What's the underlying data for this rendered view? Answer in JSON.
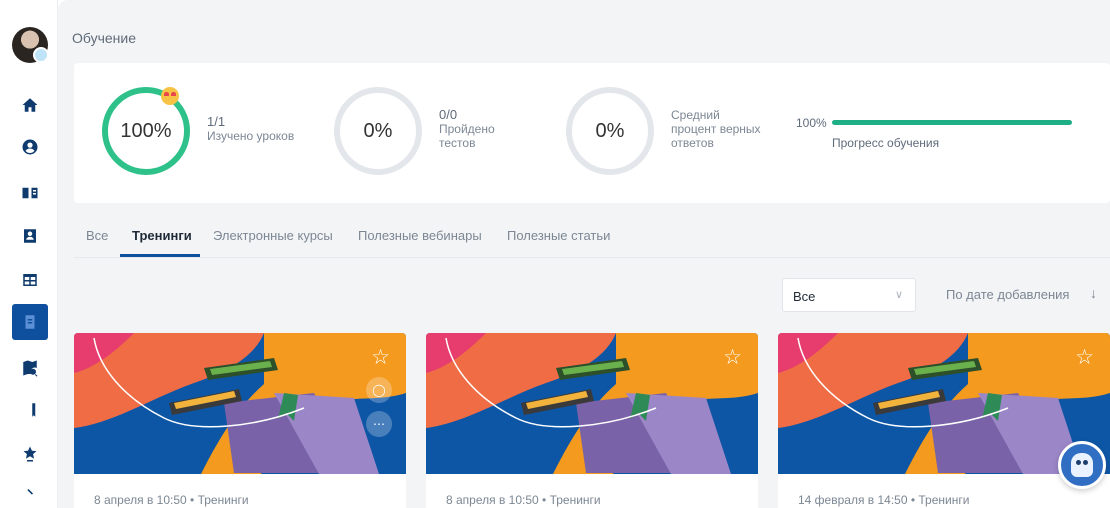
{
  "page": {
    "title": "Обучение"
  },
  "stats": {
    "lessons": {
      "ring_value": "100%",
      "count": "1/1",
      "label": "Изучено уроков",
      "progress": 1.0
    },
    "tests": {
      "ring_value": "0%",
      "count": "0/0",
      "label_line1": "Пройдено",
      "label_line2": "тестов",
      "progress": 0
    },
    "answers": {
      "ring_value": "0%",
      "label_line1": "Средний",
      "label_line2": "процент верных",
      "label_line3": "ответов",
      "progress": 0
    },
    "overall": {
      "percent": "100%",
      "label": "Прогресс обучения",
      "fraction": 1.0
    }
  },
  "tabs": [
    {
      "label": "Все",
      "active": false
    },
    {
      "label": "Тренинги",
      "active": true
    },
    {
      "label": "Электронные курсы",
      "active": false
    },
    {
      "label": "Полезные вебинары",
      "active": false
    },
    {
      "label": "Полезные статьи",
      "active": false
    }
  ],
  "filter": {
    "selected": "Все",
    "sort_label": "По дате добавления"
  },
  "cards": [
    {
      "meta": "8 апреля в 10:50 • Тренинги"
    },
    {
      "meta": "8 апреля в 10:50 • Тренинги"
    },
    {
      "meta": "14 февраля в 14:50 • Тренинги"
    }
  ],
  "icons": {
    "sidebar": [
      "home-icon",
      "profile-icon",
      "book-open-icon",
      "contacts-icon",
      "table-icon",
      "document-icon",
      "map-search-icon",
      "bookmark-icon",
      "award-icon"
    ],
    "card": [
      "star-icon",
      "focus-icon",
      "more-icon"
    ]
  },
  "colors": {
    "accent": "#0e4f9e",
    "success": "#2ec28a",
    "progress": "#1fae85",
    "nav_icon": "#0e3a6e"
  }
}
